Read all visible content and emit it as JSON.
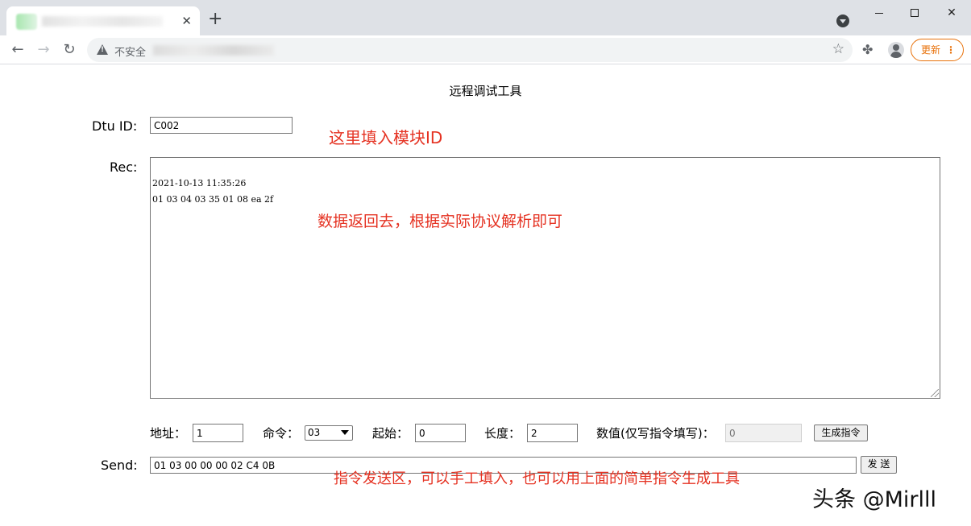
{
  "browser": {
    "new_tab_symbol": "+",
    "tab_close_symbol": "✕",
    "insecure_label": "不安全",
    "update_label": "更新",
    "update_menu_symbol": "⋮",
    "icons": [
      "back-arrow-icon",
      "forward-arrow-icon",
      "reload-icon",
      "warning-icon",
      "star-icon",
      "puzzle-extension-icon",
      "profile-avatar-icon"
    ]
  },
  "page": {
    "title": "远程调试工具",
    "dtu": {
      "label": "Dtu ID:",
      "value": "C002"
    },
    "rec": {
      "label": "Rec:",
      "lines": [
        "2021-10-13 11:35:26",
        "01 03 04 03 35 01 08 ea 2f"
      ]
    },
    "controls": {
      "address": {
        "label": "地址：",
        "value": "1"
      },
      "command": {
        "label": "命令：",
        "value": "03"
      },
      "start": {
        "label": "起始：",
        "value": "0"
      },
      "length": {
        "label": "长度：",
        "value": "2"
      },
      "value": {
        "label": "数值(仅写指令填写)：",
        "placeholder": "0"
      },
      "generate_label": "生成指令"
    },
    "send": {
      "label": "Send:",
      "value": "01 03 00 00 00 02 C4 0B",
      "button_label": "发 送"
    }
  },
  "annotations": {
    "dtu_hint": "这里填入模块ID",
    "rec_hint": "数据返回去，根据实际协议解析即可",
    "send_hint": "指令发送区，可以手工填入，也可以用上面的简单指令生成工具"
  },
  "watermark": "头条 @Mirlll",
  "colors": {
    "annotation": "#e53222",
    "update_accent": "#e8710a",
    "chrome_bg": "#dee1e6"
  }
}
